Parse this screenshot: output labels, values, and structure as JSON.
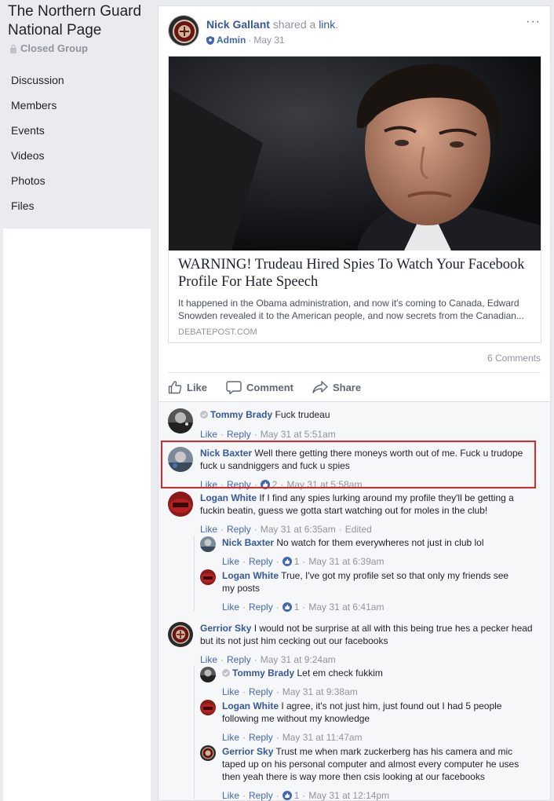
{
  "group": {
    "title": "The Northern Guard National Page",
    "privacy": "Closed Group"
  },
  "nav": [
    "Discussion",
    "Members",
    "Events",
    "Videos",
    "Photos",
    "Files"
  ],
  "post": {
    "author": "Nick Gallant",
    "action_prefix": " shared a ",
    "action_link": "link",
    "action_suffix": ".",
    "role": "Admin",
    "date": "May 31",
    "more": "···",
    "link": {
      "title": "WARNING! Trudeau Hired Spies To Watch Your Facebook Profile For Hate Speech",
      "description": "It happened in the Obama administration, and now it's coming to Canada, Edward Snowden revealed it to the American people, and now secrets from the Canadian...",
      "domain": "DEBATEPOST.COM"
    },
    "comment_count": "6 Comments",
    "actions": {
      "like": "Like",
      "comment": "Comment",
      "share": "Share"
    }
  },
  "comment_actions": {
    "like": "Like",
    "reply": "Reply"
  },
  "comments": [
    {
      "name": "Tommy Brady",
      "text": "Fuck trudeau",
      "time": "May 31 at 5:51am",
      "likes": "",
      "edited": ""
    },
    {
      "name": "Nick Baxter",
      "text": "Well there getting there moneys worth out of me. Fuck u trudope fuck u sandniggers and fuck u spies",
      "time": "May 31 at 5:58am",
      "likes": "2",
      "edited": ""
    },
    {
      "name": "Logan White",
      "text": "If I find any spies lurking around my profile they'll be getting a fuckin beatin, guess we gotta start watching out for moles in the club!",
      "time": "May 31 at 6:35am",
      "likes": "",
      "edited": "Edited"
    },
    {
      "name": "Nick Baxter",
      "text": "No watch for them everywheres not just in club lol",
      "time": "May 31 at 6:39am",
      "likes": "1",
      "edited": ""
    },
    {
      "name": "Logan White",
      "text": "True, I've got my profile set so that only my friends see my posts",
      "time": "May 31 at 6:41am",
      "likes": "1",
      "edited": ""
    },
    {
      "name": "Gerrior Sky",
      "text": "I would not be surprise at all with this being true hes a pecker head but its not just him cecking out our facebooks",
      "time": "May 31 at 9:24am",
      "likes": "",
      "edited": ""
    },
    {
      "name": "Tommy Brady",
      "text": "Let em check fukkim",
      "time": "May 31 at 9:38am",
      "likes": "",
      "edited": ""
    },
    {
      "name": "Logan White",
      "text": "I agree, it's not just him, just found out I had 5 people following me without my knowledge",
      "time": "May 31 at 11:47am",
      "likes": "",
      "edited": ""
    },
    {
      "name": "Gerrior Sky",
      "text": "Trust me when mark zuckerberg has his camera and mic taped up on his personal computer and almost every computer he uses then yeah there is way more then csis looking at our facebooks",
      "time": "May 31 at 12:14pm",
      "likes": "1",
      "edited": ""
    }
  ],
  "colors": {
    "link_blue": "#365899",
    "highlight_red": "#d9292b",
    "meta_gray": "#90949c"
  }
}
